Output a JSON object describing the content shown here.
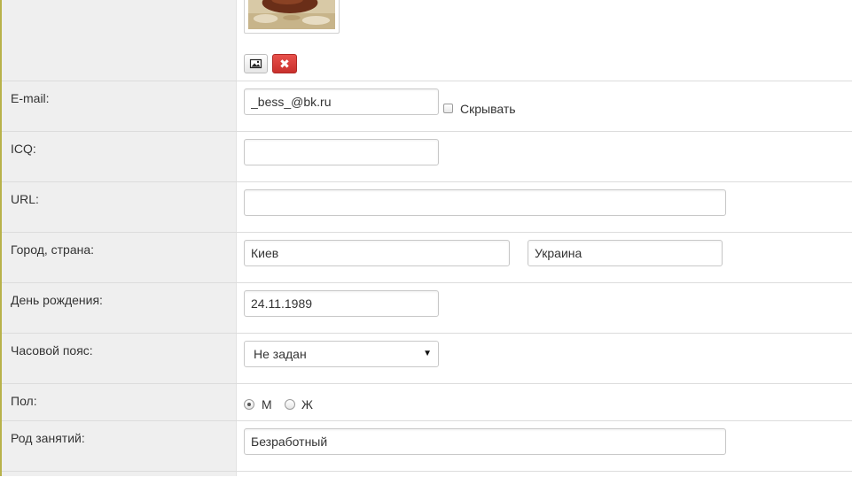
{
  "avatar": {
    "icon": "image-icon",
    "delete_label": "✖"
  },
  "email": {
    "label": "E-mail:",
    "value": "_bess_@bk.ru",
    "hide_label": "Скрывать"
  },
  "icq": {
    "label": "ICQ:",
    "value": ""
  },
  "url": {
    "label": "URL:",
    "value": ""
  },
  "location": {
    "label": "Город, страна:",
    "city": "Киев",
    "country": "Украина"
  },
  "birthday": {
    "label": "День рождения:",
    "value": "24.11.1989"
  },
  "timezone": {
    "label": "Часовой пояс:",
    "selected": "Не задан",
    "arrow": "▼"
  },
  "gender": {
    "label": "Пол:",
    "male_label": "М",
    "female_label": "Ж",
    "selected": "М"
  },
  "occupation": {
    "label": "Род занятий:",
    "value": "Безработный"
  },
  "colors": {
    "accent_line": "#b8b24a",
    "label_bg": "#efefef",
    "delete_red": "#d9534f"
  }
}
